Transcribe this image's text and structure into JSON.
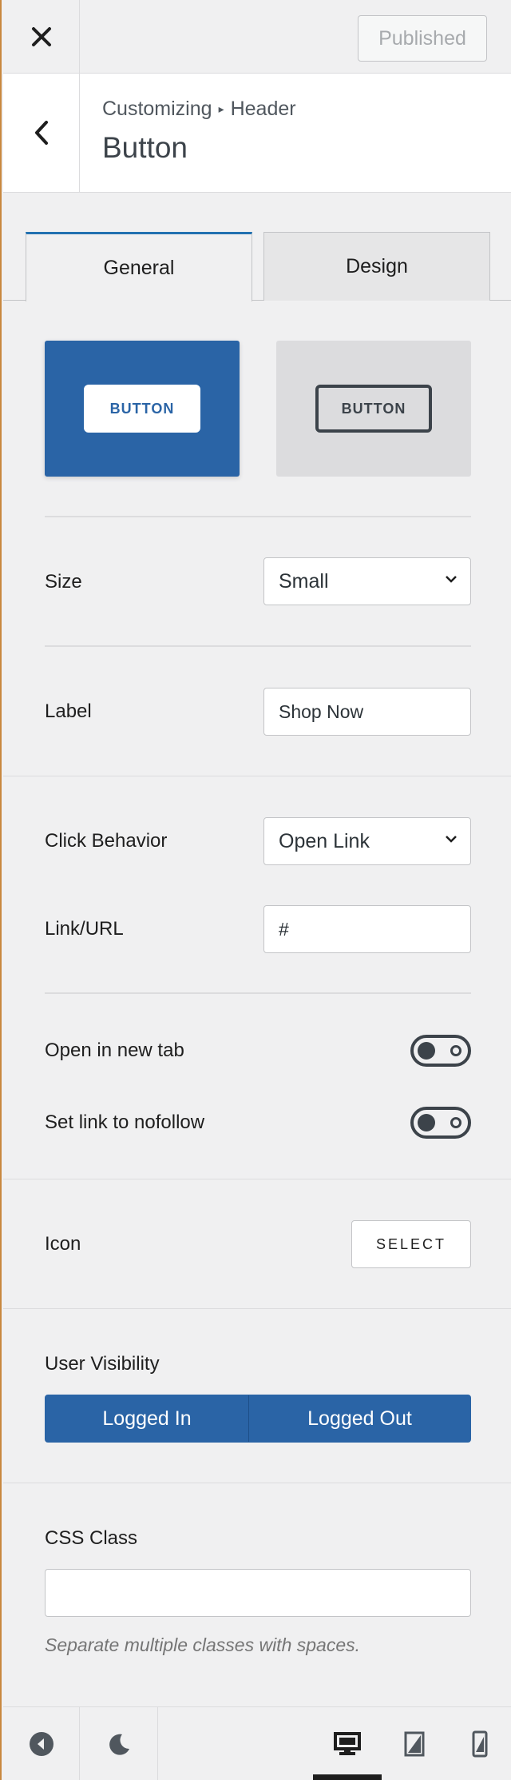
{
  "topbar": {
    "close_icon": "close-icon",
    "publish_label": "Published"
  },
  "header": {
    "breadcrumb_root": "Customizing",
    "breadcrumb_separator": "▸",
    "breadcrumb_section": "Header",
    "title": "Button"
  },
  "tabs": [
    {
      "label": "General",
      "active": true
    },
    {
      "label": "Design",
      "active": false
    }
  ],
  "style_previews": [
    {
      "label": "BUTTON",
      "style": "filled",
      "selected": true
    },
    {
      "label": "BUTTON",
      "style": "outline",
      "selected": false
    }
  ],
  "size": {
    "label": "Size",
    "value": "Small"
  },
  "label_field": {
    "label": "Label",
    "value": "Shop Now"
  },
  "click_behavior": {
    "label": "Click Behavior",
    "value": "Open Link"
  },
  "link_url": {
    "label": "Link/URL",
    "value": "#"
  },
  "open_new_tab": {
    "label": "Open in new tab",
    "enabled": false
  },
  "nofollow": {
    "label": "Set link to nofollow",
    "enabled": false
  },
  "icon": {
    "label": "Icon",
    "button": "SELECT"
  },
  "user_visibility": {
    "label": "User Visibility",
    "options": [
      "Logged In",
      "Logged Out"
    ]
  },
  "css_class": {
    "label": "CSS Class",
    "value": "",
    "help": "Separate multiple classes with spaces."
  },
  "colors": {
    "accent": "#2a64a6",
    "background": "#f0f0f1",
    "border": "#c3c4c7"
  }
}
